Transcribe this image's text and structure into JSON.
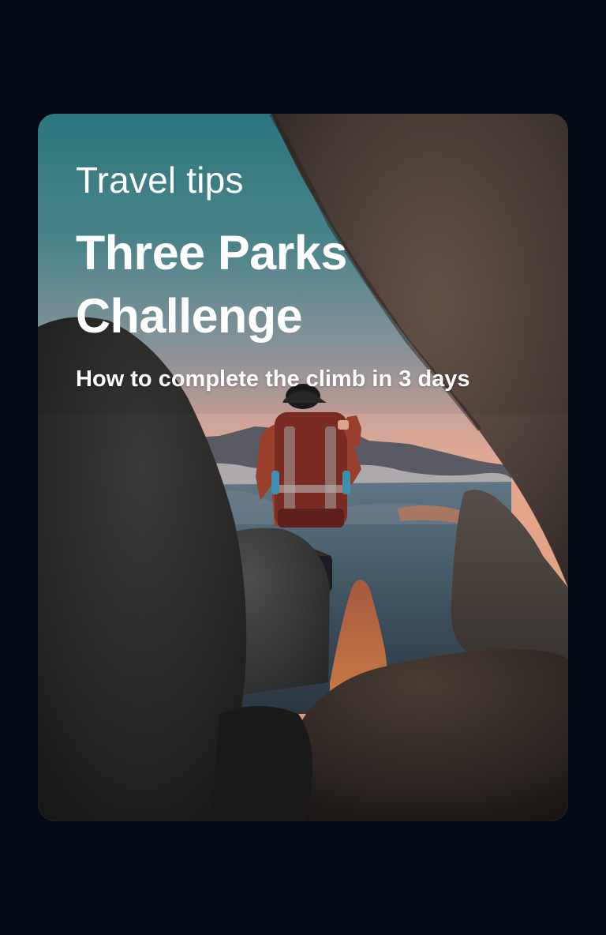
{
  "card": {
    "eyebrow": "Travel tips",
    "title_line1": "Three Parks",
    "title_line2": "Challenge",
    "subtitle": "How to complete the climb in 3 days",
    "image": "hiker-between-rocks-photo"
  },
  "colors": {
    "page_background": "#040a16",
    "text": "#ffffff",
    "sky_top": "#2f7f86",
    "sky_horizon": "#e8a98f"
  }
}
